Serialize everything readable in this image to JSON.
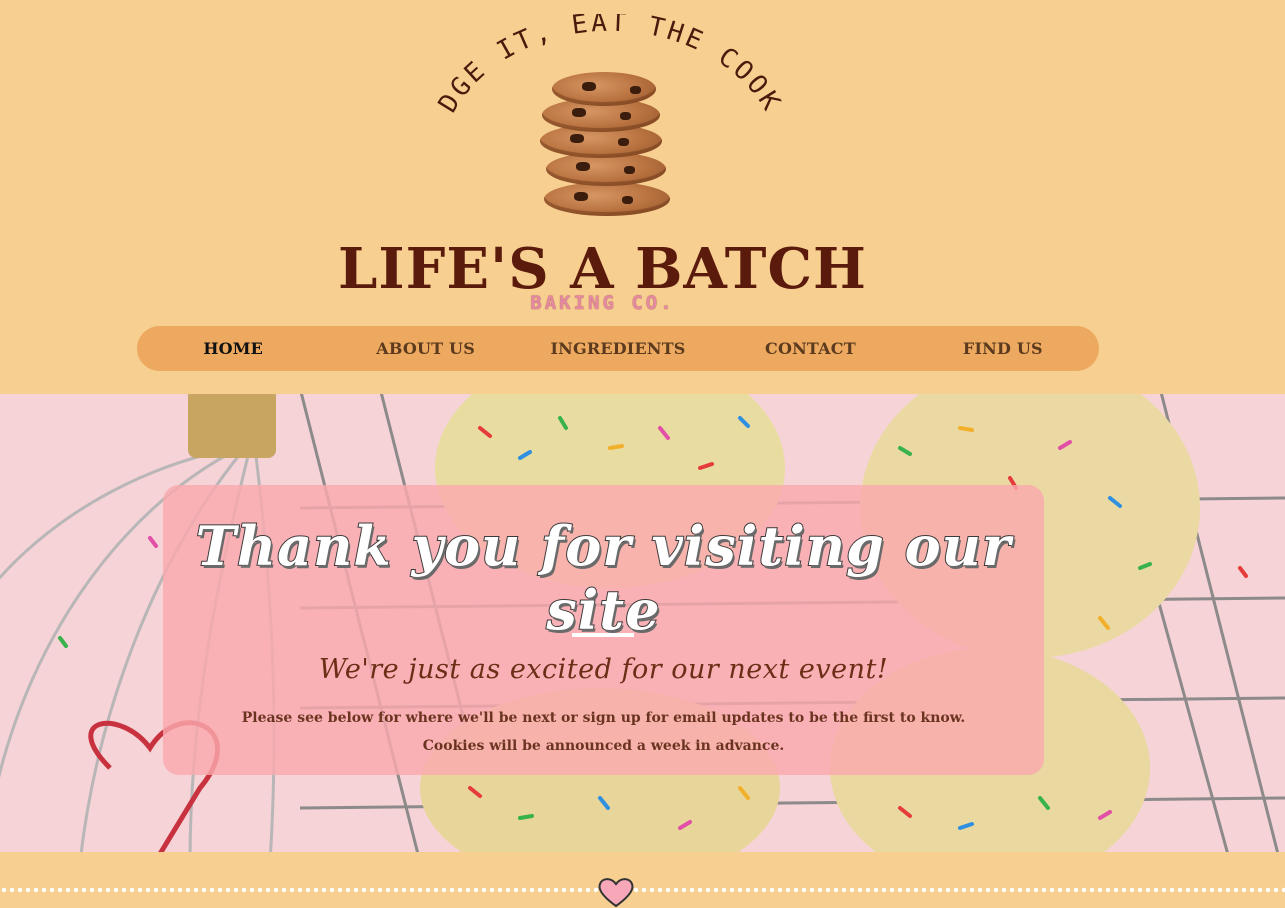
{
  "logo": {
    "tagline": "FUDGE IT, EAT THE COOKIE",
    "title": "LIFE'S A BATCH",
    "subtitle": "BAKING CO.",
    "image": "cookie-stack-icon"
  },
  "nav": {
    "items": [
      {
        "label": "HOME",
        "active": true
      },
      {
        "label": "ABOUT US",
        "active": false
      },
      {
        "label": "INGREDIENTS",
        "active": false
      },
      {
        "label": "CONTACT",
        "active": false
      },
      {
        "label": "FIND US",
        "active": false
      }
    ]
  },
  "hero": {
    "headline": "Thank you for visiting our site",
    "subhead": "We're just as excited for our next event!",
    "line1": "Please see below for where we'll be next or sign up for email updates to be the first to know.",
    "line2": "Cookies will be announced a week in advance.",
    "background": "sprinkle-cookies-on-cooling-rack-with-whisk"
  },
  "footer": {
    "divider_icon": "heart-icon"
  },
  "colors": {
    "page_bg": "#f7cf90",
    "nav_bg": "#eda95f",
    "brand_brown": "#5a1a0c",
    "brand_pink": "#e58aa0",
    "overlay_pink": "#faaaaf"
  }
}
